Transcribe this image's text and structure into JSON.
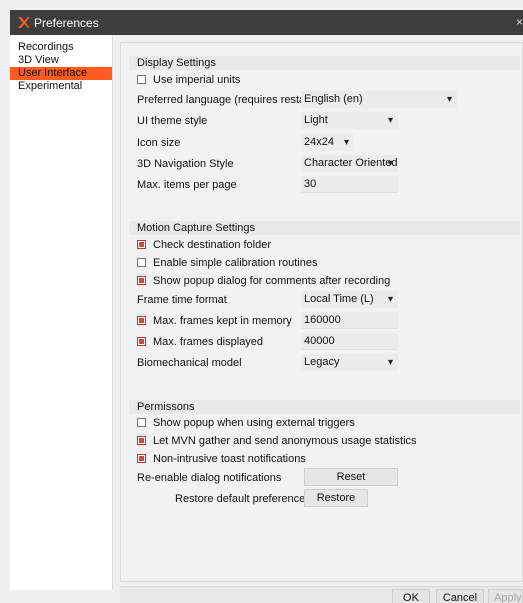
{
  "window": {
    "title": "Preferences",
    "close_glyph": "×"
  },
  "sidebar": {
    "items": [
      {
        "label": "Recordings"
      },
      {
        "label": "3D View"
      },
      {
        "label": "User Interface"
      },
      {
        "label": "Experimental"
      }
    ]
  },
  "display": {
    "header": "Display Settings",
    "imperial_label": "Use imperial units",
    "imperial_checked": false,
    "language_label": "Preferred language (requires restart)",
    "language_value": "English (en)",
    "theme_label": "UI theme style",
    "theme_value": "Light",
    "icon_label": "Icon size",
    "icon_value": "24x24",
    "nav_label": "3D Navigation Style",
    "nav_value": "Character Oriented",
    "maxitems_label": "Max. items per page",
    "maxitems_value": "30"
  },
  "mocap": {
    "header": "Motion Capture Settings",
    "check_dest_label": "Check destination folder",
    "check_dest_checked": true,
    "simple_calib_label": "Enable simple calibration routines",
    "simple_calib_checked": false,
    "popup_comments_label": "Show popup dialog for comments after recording",
    "popup_comments_checked": true,
    "frame_time_label": "Frame time format",
    "frame_time_value": "Local Time (L)",
    "frames_memory_label": "Max. frames kept in memory",
    "frames_memory_checked": true,
    "frames_memory_value": "160000",
    "frames_displayed_label": "Max.  frames displayed",
    "frames_displayed_checked": true,
    "frames_displayed_value": "40000",
    "bio_label": "Biomechanical model",
    "bio_value": "Legacy"
  },
  "permissions": {
    "header": "Permissons",
    "ext_triggers_label": "Show popup when using external triggers",
    "ext_triggers_checked": false,
    "anon_stats_label": "Let MVN gather and send anonymous usage statistics",
    "anon_stats_checked": true,
    "toast_label": "Non-intrusive toast notifications",
    "toast_checked": true,
    "reenable_label": "Re-enable dialog notifications",
    "reset_label": "Reset",
    "restore_defaults_label": "Restore default preferences",
    "restore_label": "Restore"
  },
  "footer": {
    "ok": "OK",
    "cancel": "Cancel",
    "apply": "Apply"
  },
  "colors": {
    "accent": "#ff5a1f",
    "titlebar": "#3d3d3d",
    "checked": "#d04a3a"
  }
}
